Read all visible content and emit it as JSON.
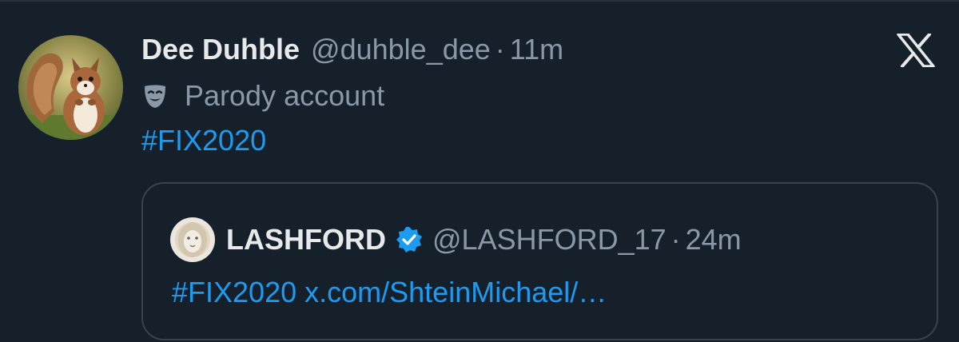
{
  "post": {
    "author": {
      "display_name": "Dee Duhble",
      "handle": "@duhble_dee",
      "separator": "·",
      "time": "11m",
      "avatar_icon": "squirrel-avatar"
    },
    "account_label": {
      "icon": "theater-mask-icon",
      "text": "Parody account"
    },
    "text": "#FIX2020",
    "platform_icon": "x-logo-icon"
  },
  "quote": {
    "author": {
      "display_name": "LASHFORD",
      "verified": true,
      "handle": "@LASHFORD_17",
      "separator": "·",
      "time": "24m",
      "avatar_icon": "lion-avatar"
    },
    "hashtag": "#FIX2020",
    "link": "x.com/ShteinMichael/…"
  },
  "colors": {
    "background": "#15202b",
    "primary_text": "#e7e9ea",
    "secondary_text": "#8b98a5",
    "link": "#1d9bf0",
    "border": "#38444d",
    "verified": "#1d9bf0"
  }
}
